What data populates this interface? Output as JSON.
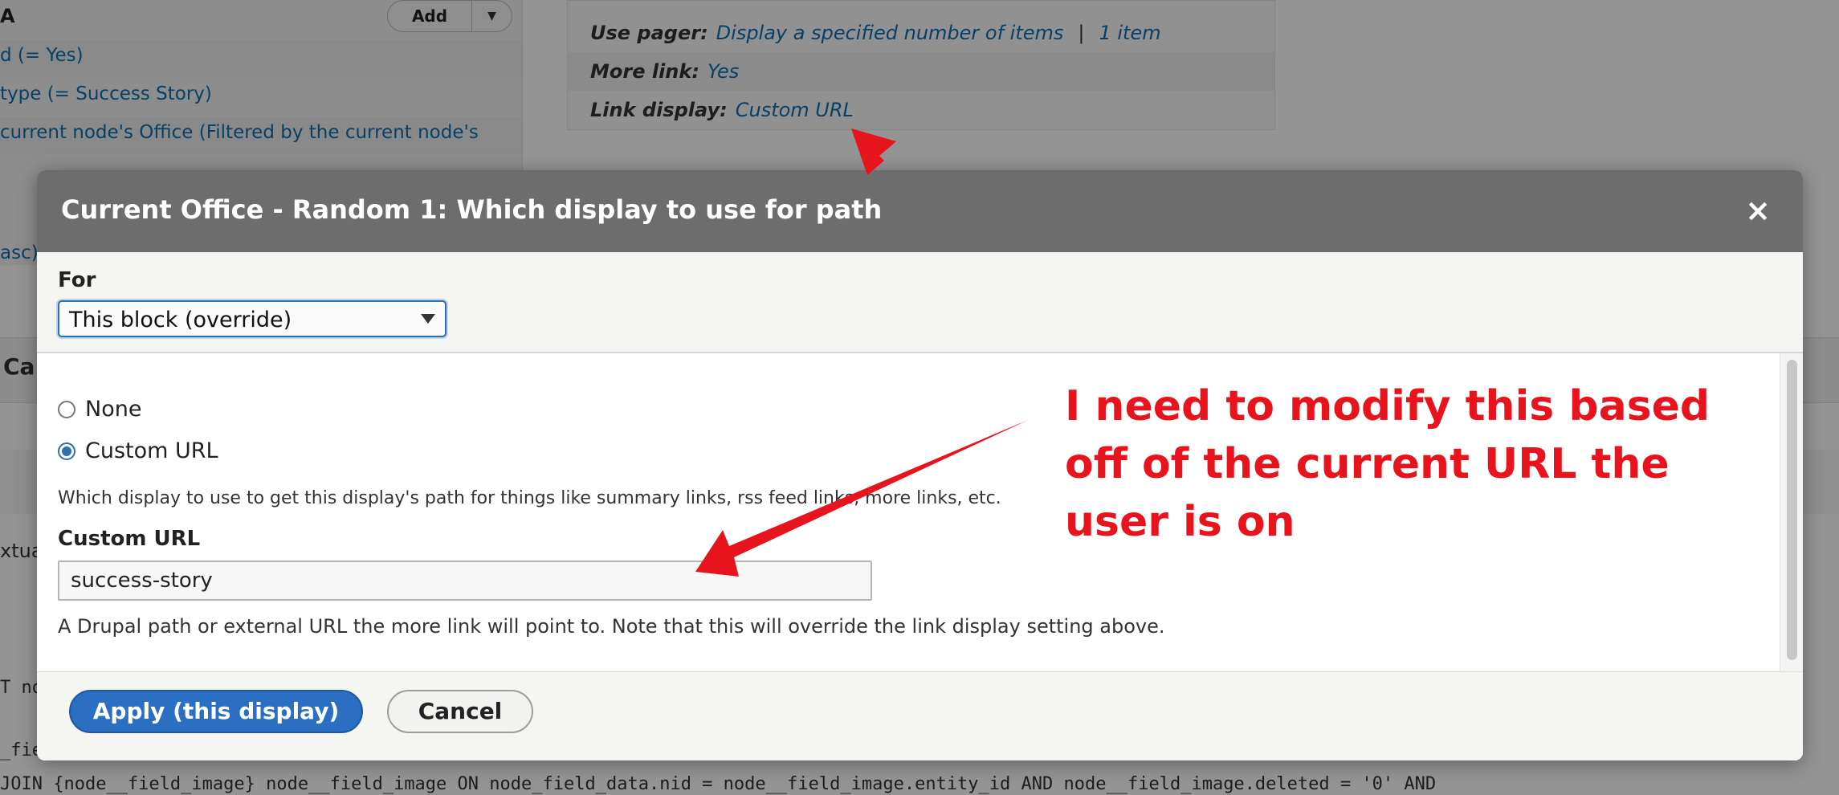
{
  "background": {
    "add_button_label": "Add",
    "section_a": "A",
    "filter_1": "d (= Yes)",
    "filter_2": "type (= Success Story)",
    "filter_3": "current node's Office (Filtered by the current node's",
    "sort_1": "asc)",
    "tab_fragment": "Ca",
    "contextual_fragment": "xtua",
    "pager_label": "Use pager:",
    "pager_value": "Display a specified number of items",
    "pager_sep": "|",
    "pager_count": "1 item",
    "more_link_label": "More link:",
    "more_link_value": "Yes",
    "link_display_label": "Link display:",
    "link_display_value": "Custom URL",
    "sql_1": "T no",
    "sql_2": "_fie",
    "sql_3": "JOIN {node__field_image} node__field_image ON node_field_data.nid = node__field_image.entity_id AND node__field_image.deleted = '0' AND"
  },
  "dialog": {
    "title": "Current Office - Random 1: Which display to use for path",
    "close_icon": "×",
    "for_label": "For",
    "for_selected": "This block (override)",
    "options": [
      {
        "label": "None",
        "checked": false
      },
      {
        "label": "Custom URL",
        "checked": true
      }
    ],
    "option_description": "Which display to use to get this display's path for things like summary links, rss feed links, more links, etc.",
    "custom_url_label": "Custom URL",
    "custom_url_value": "success-story",
    "custom_url_description": "A Drupal path or external URL the more link will point to. Note that this will override the link display setting above.",
    "apply_label": "Apply (this display)",
    "cancel_label": "Cancel"
  },
  "annotation": {
    "text": "I need to modify this based off of the current URL the user is on",
    "color": "#e8141d"
  },
  "colors": {
    "accent": "#2a6fc2",
    "link": "#0d6fb0",
    "titlebar": "#6d6d6d"
  }
}
